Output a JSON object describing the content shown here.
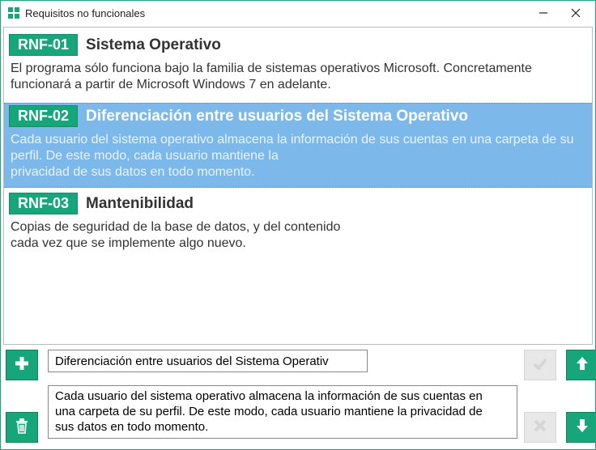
{
  "window": {
    "title": "Requisitos no funcionales"
  },
  "requirements": [
    {
      "id": "RNF-01",
      "title": "Sistema Operativo",
      "body": "El programa sólo funciona bajo la familia de sistemas operativos Microsoft. Concretamente funcionará a partir de Microsoft Windows 7 en adelante.",
      "selected": false
    },
    {
      "id": "RNF-02",
      "title": "Diferenciación entre usuarios del Sistema Operativo",
      "body_line1": "Cada usuario del sistema operativo almacena la información de sus cuentas en una carpeta de su perfil. De este modo, cada usuario mantiene la",
      "body_line2": "privacidad de sus datos en todo momento.",
      "selected": true
    },
    {
      "id": "RNF-03",
      "title": "Mantenibilidad",
      "body_line1": " Copias de seguridad de la base de datos, y del contenido",
      "body_line2": "cada vez que se implemente algo nuevo.",
      "selected": false
    }
  ],
  "editor": {
    "title_value": "Diferenciación entre usuarios del Sistema Operativ",
    "body_value": "Cada usuario del sistema operativo almacena la información de sus cuentas en una carpeta de su perfil. De este modo, cada usuario mantiene la privacidad de sus datos en todo momento."
  },
  "colors": {
    "accent": "#17a67a",
    "selection": "#7cb9ea"
  }
}
